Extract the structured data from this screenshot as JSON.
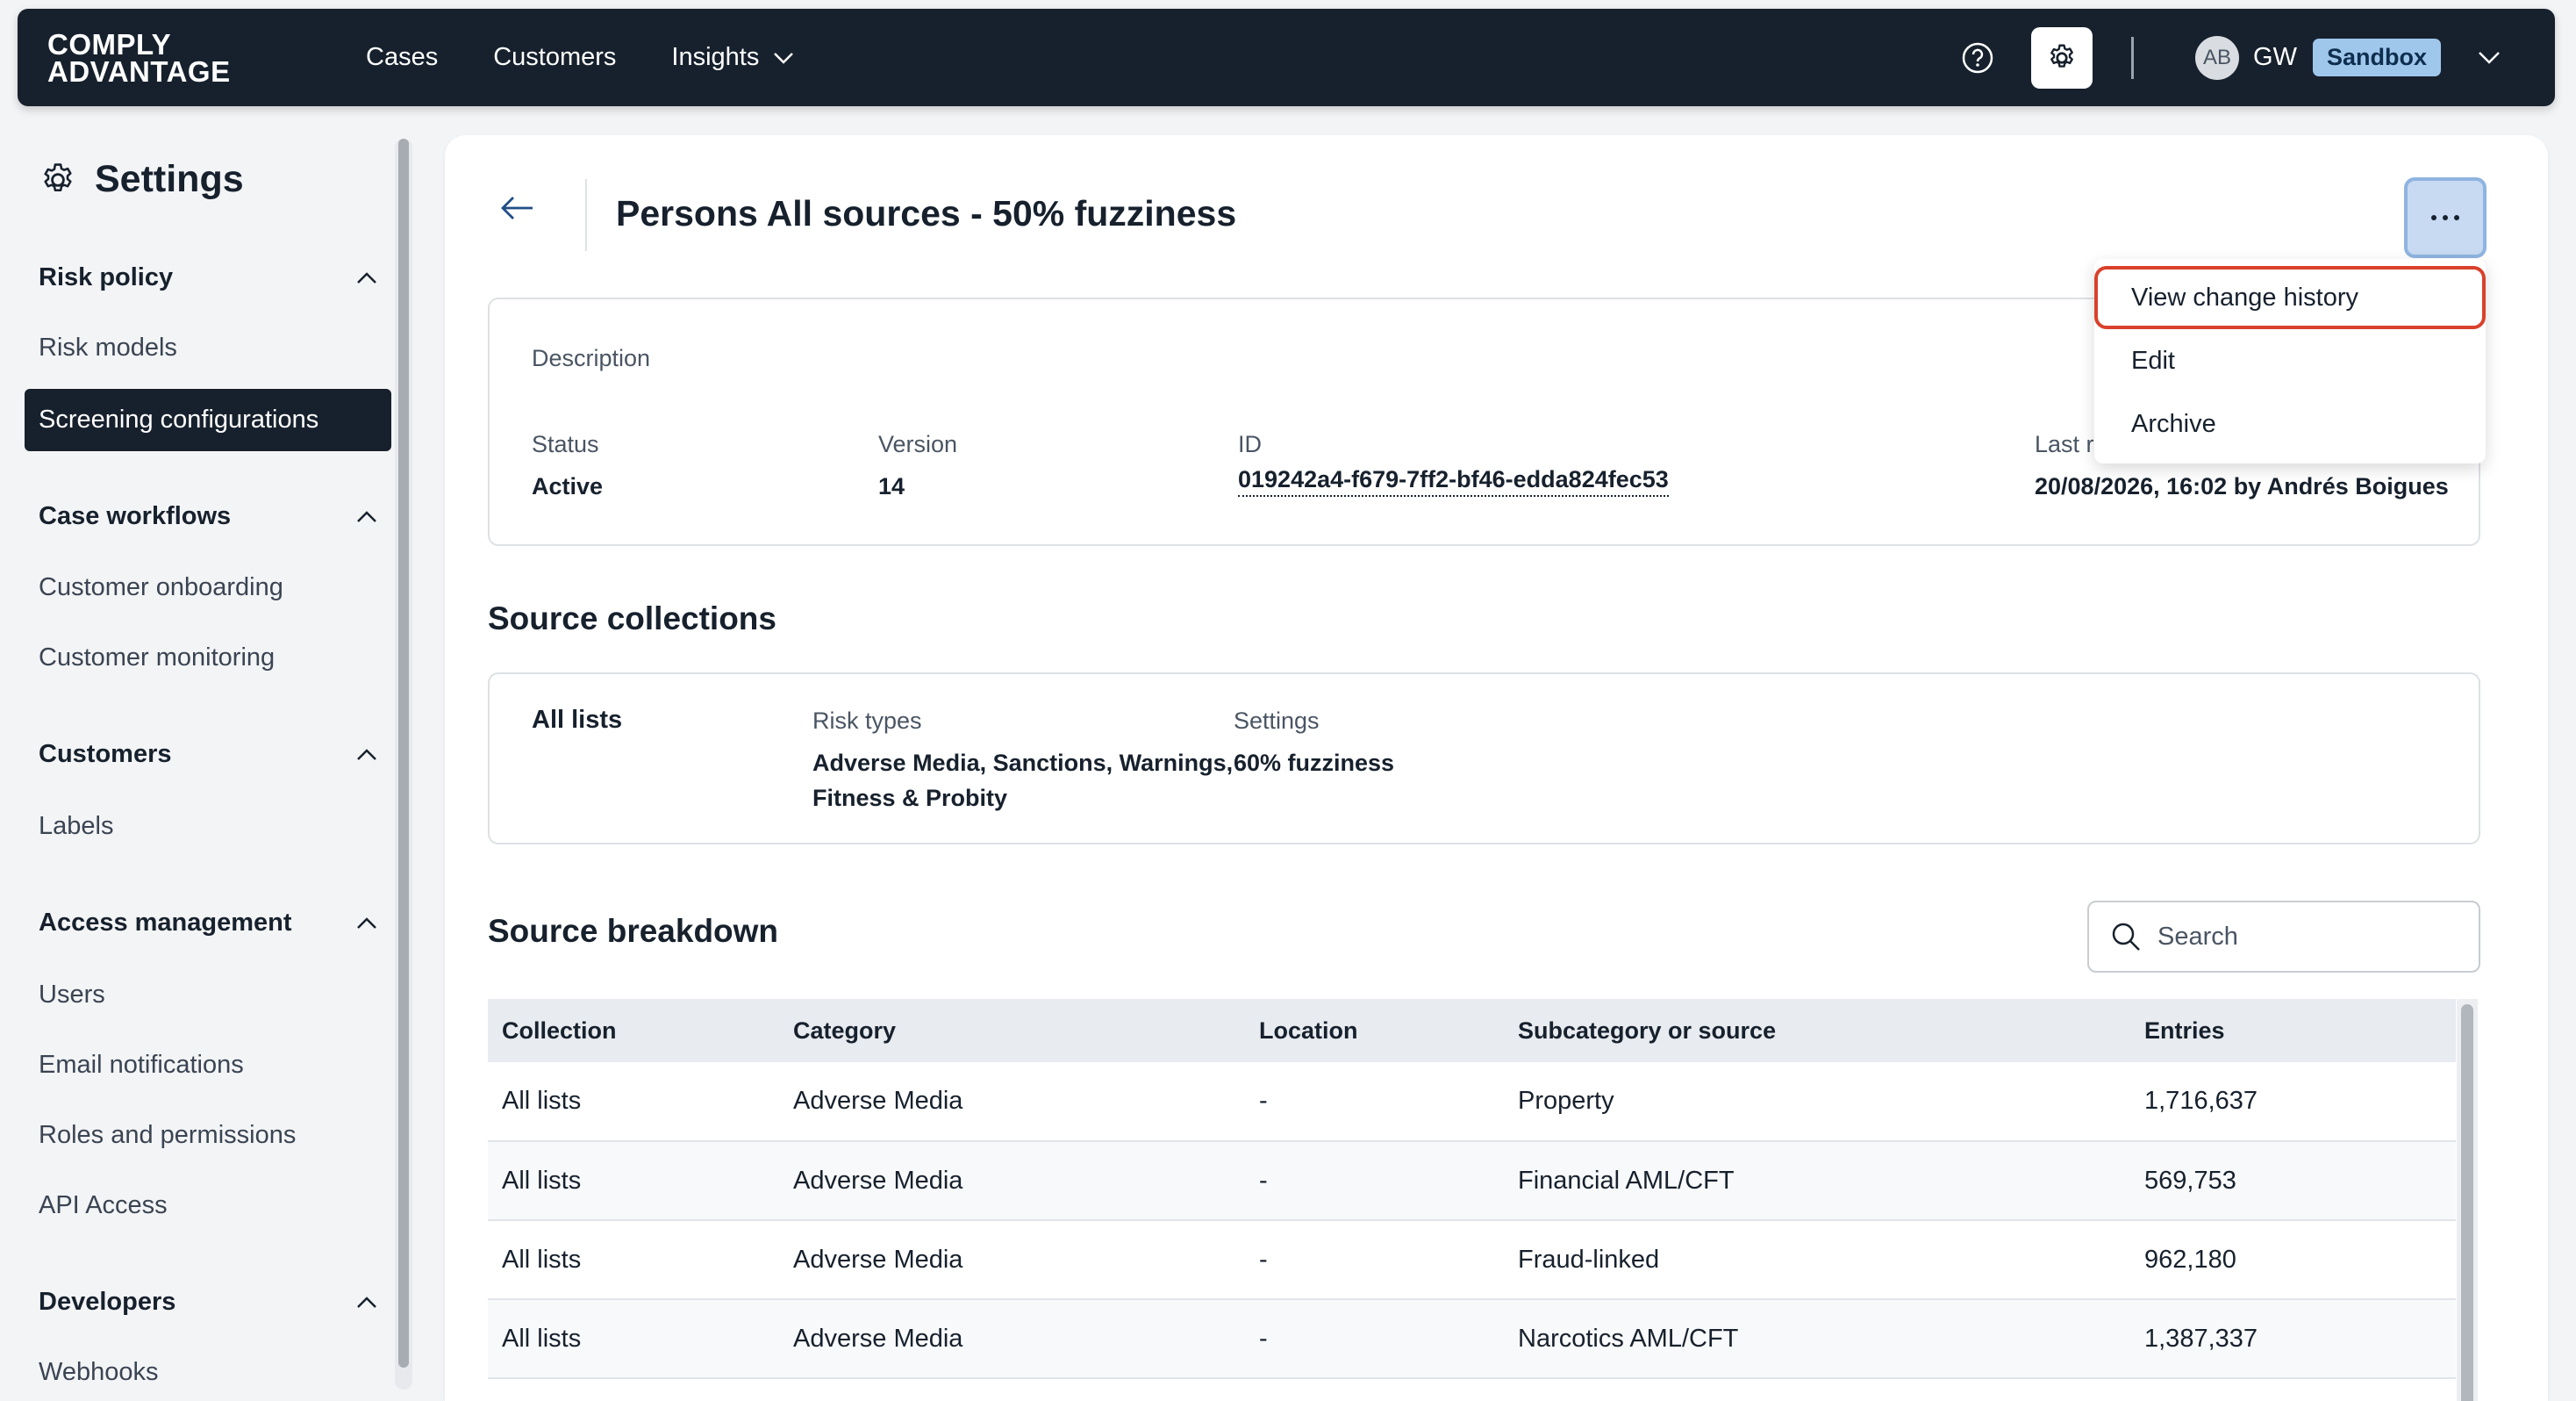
{
  "nav": {
    "logo_line1": "COMPLY",
    "logo_line2": "ADVANTAGE",
    "links": [
      "Cases",
      "Customers",
      "Insights"
    ],
    "avatar_initials": "AB",
    "user_initials": "GW",
    "environment_badge": "Sandbox"
  },
  "sidebar": {
    "title": "Settings",
    "sections": [
      {
        "label": "Risk policy",
        "items": [
          "Risk models",
          "Screening configurations"
        ]
      },
      {
        "label": "Case workflows",
        "items": [
          "Customer onboarding",
          "Customer monitoring"
        ]
      },
      {
        "label": "Customers",
        "items": [
          "Labels"
        ]
      },
      {
        "label": "Access management",
        "items": [
          "Users",
          "Email notifications",
          "Roles and permissions",
          "API Access"
        ]
      },
      {
        "label": "Developers",
        "items": [
          "Webhooks"
        ]
      }
    ],
    "active_item": "Screening configurations"
  },
  "page": {
    "title": "Persons All sources - 50% fuzziness",
    "menu": [
      "View change history",
      "Edit",
      "Archive"
    ],
    "details": {
      "description_label": "Description",
      "status_label": "Status",
      "status_value": "Active",
      "version_label": "Version",
      "version_value": "14",
      "id_label": "ID",
      "id_value": "019242a4-f679-7ff2-bf46-edda824fec53",
      "last_modified_label": "Last r",
      "last_modified_value": "20/08/2026, 16:02 by Andrés Boigues"
    },
    "source_collections": {
      "title": "Source collections",
      "name": "All lists",
      "risk_types_label": "Risk types",
      "risk_types_line1": "Adverse Media, Sanctions, Warnings,",
      "risk_types_line2": "Fitness & Probity",
      "settings_label": "Settings",
      "settings_value": "60% fuzziness"
    },
    "source_breakdown": {
      "title": "Source breakdown",
      "search_placeholder": "Search",
      "columns": [
        "Collection",
        "Category",
        "Location",
        "Subcategory or source",
        "Entries"
      ],
      "rows": [
        [
          "All lists",
          "Adverse Media",
          "-",
          "Property",
          "1,716,637"
        ],
        [
          "All lists",
          "Adverse Media",
          "-",
          "Financial AML/CFT",
          "569,753"
        ],
        [
          "All lists",
          "Adverse Media",
          "-",
          "Fraud-linked",
          "962,180"
        ],
        [
          "All lists",
          "Adverse Media",
          "-",
          "Narcotics AML/CFT",
          "1,387,337"
        ]
      ]
    }
  }
}
